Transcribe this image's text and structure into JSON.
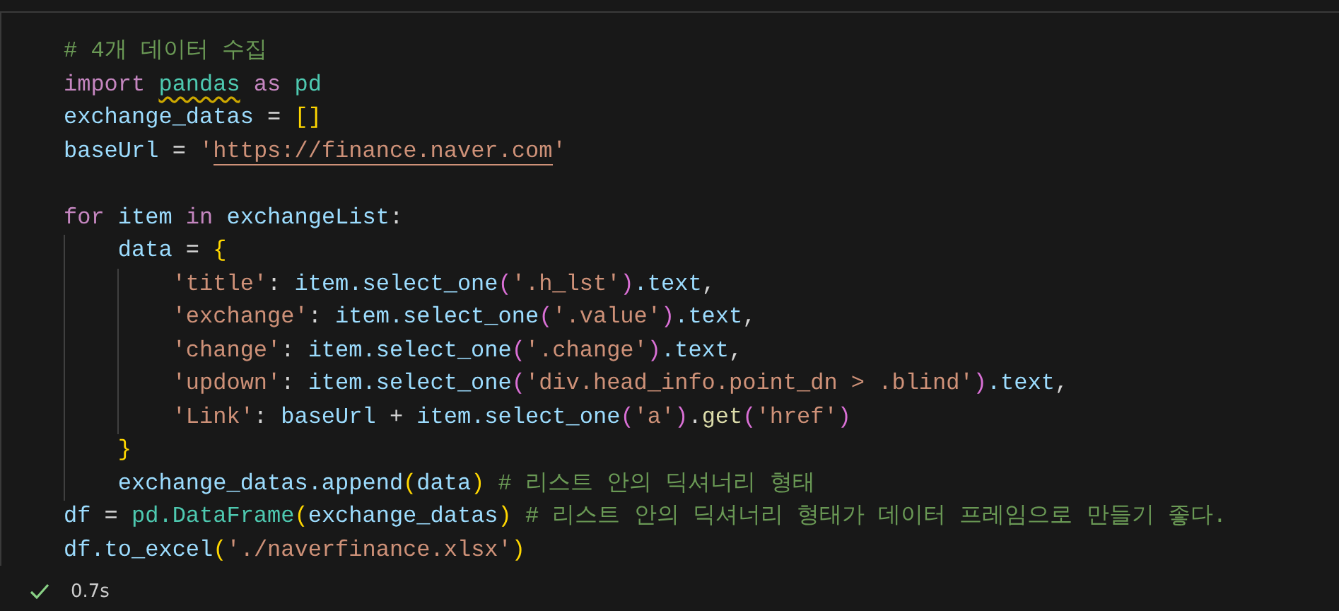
{
  "cell": {
    "lines": [
      {
        "kind": "code",
        "tokens": [
          {
            "kind": "cm",
            "text": "# 4개 데이터 수집"
          }
        ]
      },
      {
        "kind": "code",
        "tokens": [
          {
            "kind": "kw",
            "text": "import "
          },
          {
            "kind": "cls",
            "text": "pandas",
            "warning": true
          },
          {
            "kind": "kw",
            "text": " as "
          },
          {
            "kind": "cls",
            "text": "pd"
          }
        ]
      },
      {
        "kind": "code",
        "tokens": [
          {
            "kind": "var",
            "text": "exchange_datas"
          },
          {
            "kind": "op",
            "text": " = "
          },
          {
            "kind": "b1",
            "text": "[]"
          }
        ]
      },
      {
        "kind": "code",
        "tokens": [
          {
            "kind": "var",
            "text": "baseUrl"
          },
          {
            "kind": "op",
            "text": " = "
          },
          {
            "kind": "str",
            "text": "'"
          },
          {
            "kind": "str",
            "text": "https://finance.naver.com",
            "link": true
          },
          {
            "kind": "str",
            "text": "'"
          }
        ]
      },
      {
        "kind": "blank"
      },
      {
        "kind": "code",
        "tokens": [
          {
            "kind": "kw",
            "text": "for "
          },
          {
            "kind": "var",
            "text": "item "
          },
          {
            "kind": "kw",
            "text": "in "
          },
          {
            "kind": "var",
            "text": "exchangeList"
          },
          {
            "kind": "op",
            "text": ":"
          }
        ]
      },
      {
        "kind": "code",
        "tokens": [
          {
            "kind": "var",
            "text": "    data"
          },
          {
            "kind": "op",
            "text": " = "
          },
          {
            "kind": "b1",
            "text": "{"
          }
        ]
      },
      {
        "kind": "code",
        "tokens": [
          {
            "kind": "str",
            "text": "        'title'"
          },
          {
            "kind": "op",
            "text": ": "
          },
          {
            "kind": "var",
            "text": "item.select_one"
          },
          {
            "kind": "b2",
            "text": "("
          },
          {
            "kind": "str",
            "text": "'.h_lst'"
          },
          {
            "kind": "b2",
            "text": ")"
          },
          {
            "kind": "var",
            "text": ".text"
          },
          {
            "kind": "op",
            "text": ","
          }
        ]
      },
      {
        "kind": "code",
        "tokens": [
          {
            "kind": "str",
            "text": "        'exchange'"
          },
          {
            "kind": "op",
            "text": ": "
          },
          {
            "kind": "var",
            "text": "item.select_one"
          },
          {
            "kind": "b2",
            "text": "("
          },
          {
            "kind": "str",
            "text": "'.value'"
          },
          {
            "kind": "b2",
            "text": ")"
          },
          {
            "kind": "var",
            "text": ".text"
          },
          {
            "kind": "op",
            "text": ","
          }
        ]
      },
      {
        "kind": "code",
        "tokens": [
          {
            "kind": "str",
            "text": "        'change'"
          },
          {
            "kind": "op",
            "text": ": "
          },
          {
            "kind": "var",
            "text": "item.select_one"
          },
          {
            "kind": "b2",
            "text": "("
          },
          {
            "kind": "str",
            "text": "'.change'"
          },
          {
            "kind": "b2",
            "text": ")"
          },
          {
            "kind": "var",
            "text": ".text"
          },
          {
            "kind": "op",
            "text": ","
          }
        ]
      },
      {
        "kind": "code",
        "tokens": [
          {
            "kind": "str",
            "text": "        'updown'"
          },
          {
            "kind": "op",
            "text": ": "
          },
          {
            "kind": "var",
            "text": "item.select_one"
          },
          {
            "kind": "b2",
            "text": "("
          },
          {
            "kind": "str",
            "text": "'div.head_info.point_dn > .blind'"
          },
          {
            "kind": "b2",
            "text": ")"
          },
          {
            "kind": "var",
            "text": ".text"
          },
          {
            "kind": "op",
            "text": ","
          }
        ]
      },
      {
        "kind": "code",
        "tokens": [
          {
            "kind": "str",
            "text": "        'Link'"
          },
          {
            "kind": "op",
            "text": ": "
          },
          {
            "kind": "var",
            "text": "baseUrl"
          },
          {
            "kind": "op",
            "text": " + "
          },
          {
            "kind": "var",
            "text": "item.select_one"
          },
          {
            "kind": "b2",
            "text": "("
          },
          {
            "kind": "str",
            "text": "'a'"
          },
          {
            "kind": "b2",
            "text": ")"
          },
          {
            "kind": "op",
            "text": "."
          },
          {
            "kind": "fn",
            "text": "get"
          },
          {
            "kind": "b2",
            "text": "("
          },
          {
            "kind": "str",
            "text": "'href'"
          },
          {
            "kind": "b2",
            "text": ")"
          }
        ]
      },
      {
        "kind": "code",
        "tokens": [
          {
            "kind": "b1",
            "text": "    }"
          }
        ]
      },
      {
        "kind": "code",
        "tokens": [
          {
            "kind": "var",
            "text": "    exchange_datas.append"
          },
          {
            "kind": "b1",
            "text": "("
          },
          {
            "kind": "var",
            "text": "data"
          },
          {
            "kind": "b1",
            "text": ")"
          },
          {
            "kind": "cm",
            "text": " # 리스트 안의 딕셔너리 형태"
          }
        ]
      },
      {
        "kind": "code",
        "tokens": [
          {
            "kind": "var",
            "text": "df"
          },
          {
            "kind": "op",
            "text": " = "
          },
          {
            "kind": "cls",
            "text": "pd.DataFrame"
          },
          {
            "kind": "b1",
            "text": "("
          },
          {
            "kind": "var",
            "text": "exchange_datas"
          },
          {
            "kind": "b1",
            "text": ")"
          },
          {
            "kind": "cm",
            "text": " # 리스트 안의 딕셔너리 형태가 데이터 프레임으로 만들기 좋다."
          }
        ]
      },
      {
        "kind": "code",
        "tokens": [
          {
            "kind": "var",
            "text": "df.to_excel"
          },
          {
            "kind": "b1",
            "text": "("
          },
          {
            "kind": "str",
            "text": "'./naverfinance.xlsx'"
          },
          {
            "kind": "b1",
            "text": ")"
          }
        ]
      }
    ]
  },
  "status": {
    "success": true,
    "duration": "0.7s"
  }
}
